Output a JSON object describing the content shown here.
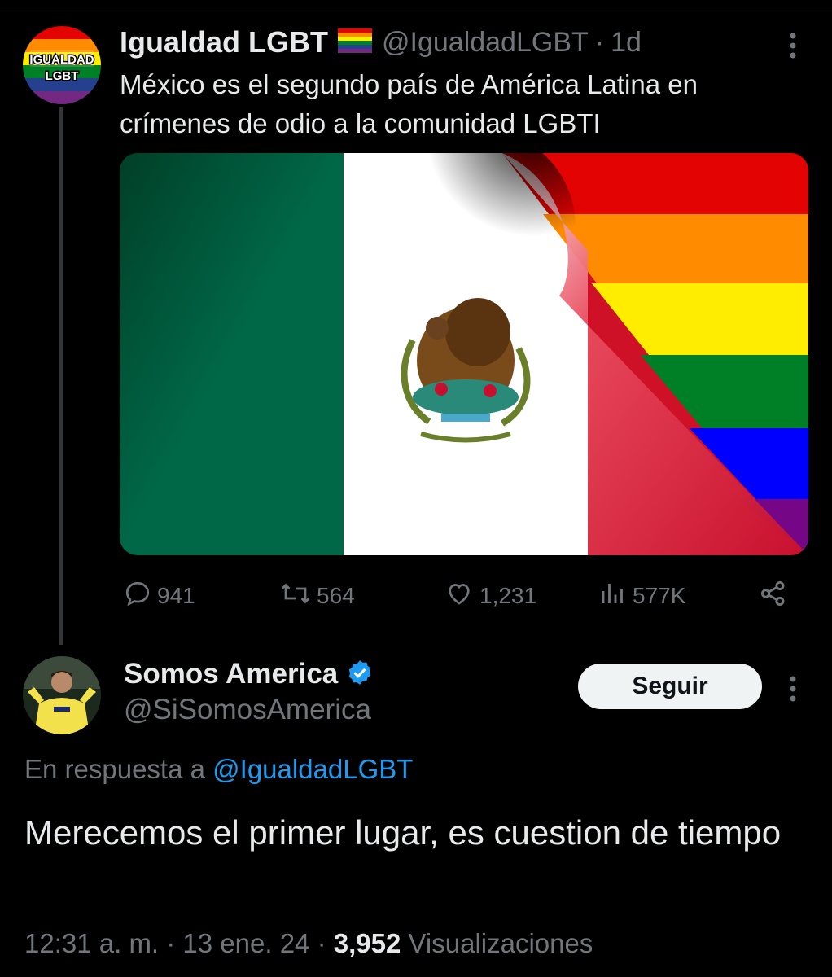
{
  "tweet1": {
    "author_name": "Igualdad LGBT",
    "handle": "@IgualdadLGBT",
    "separator": "·",
    "time": "1d",
    "text": "México es el segundo país de América Latina en crímenes de odio a la comunidad LGBTI",
    "avatar_text_line1": "IGUALDAD",
    "avatar_text_line2": "LGBT",
    "actions": {
      "replies": "941",
      "retweets": "564",
      "likes": "1,231",
      "views": "577K"
    }
  },
  "tweet2": {
    "author_name": "Somos America",
    "handle": "@SiSomosAmerica",
    "follow_label": "Seguir",
    "reply_prefix": "En respuesta a",
    "reply_mention": "@IgualdadLGBT",
    "text": "Merecemos el primer lugar, es cuestion de tiempo",
    "timestamp": "12:31 a. m. · 13 ene. 24 ·",
    "views_count": "3,952",
    "views_label": "Visualizaciones"
  },
  "icons": {
    "more": "more-vertical-icon",
    "reply": "reply-icon",
    "retweet": "retweet-icon",
    "like": "heart-icon",
    "views": "views-icon",
    "share": "share-icon",
    "verified": "verified-badge-icon",
    "rainbow_flag": "rainbow-flag-icon"
  },
  "colors": {
    "background": "#000000",
    "text": "#e7e9ea",
    "secondary": "#71767b",
    "link": "#1d9bf0",
    "follow_bg": "#eff3f4"
  }
}
